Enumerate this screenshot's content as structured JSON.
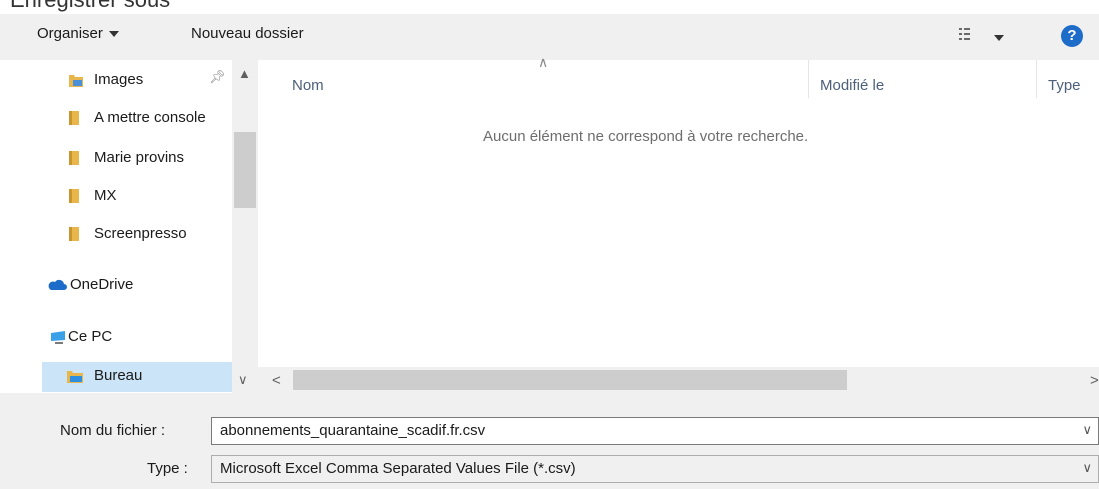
{
  "window": {
    "title": "Enregistrer sous"
  },
  "toolbar": {
    "organize_label": "Organiser",
    "new_folder_label": "Nouveau dossier",
    "help_label": "?"
  },
  "nav": {
    "items": [
      {
        "label": "Images",
        "icon": "images-folder-icon",
        "pinned": true
      },
      {
        "label": "A mettre console",
        "icon": "folder-icon"
      },
      {
        "label": "Marie provins",
        "icon": "folder-icon"
      },
      {
        "label": "MX",
        "icon": "folder-icon"
      },
      {
        "label": "Screenpresso",
        "icon": "folder-icon"
      },
      {
        "label": "OneDrive",
        "icon": "onedrive-icon"
      },
      {
        "label": "Ce PC",
        "icon": "this-pc-icon"
      },
      {
        "label": "Bureau",
        "icon": "desktop-folder-icon",
        "selected": true
      }
    ]
  },
  "content": {
    "columns": [
      "Nom",
      "Modifié le",
      "Type"
    ],
    "empty_message": "Aucun élément ne correspond à votre recherche."
  },
  "form": {
    "filename_label": "Nom du fichier :",
    "filename_value": "abonnements_quarantaine_scadif.fr.csv",
    "type_label": "Type :",
    "type_value": "Microsoft Excel Comma Separated Values File (*.csv)"
  },
  "colors": {
    "accent": "#1e6cc9",
    "folder": "#e8b64a",
    "selected_bg": "#cce4f7",
    "chrome": "#f0f0f0"
  }
}
